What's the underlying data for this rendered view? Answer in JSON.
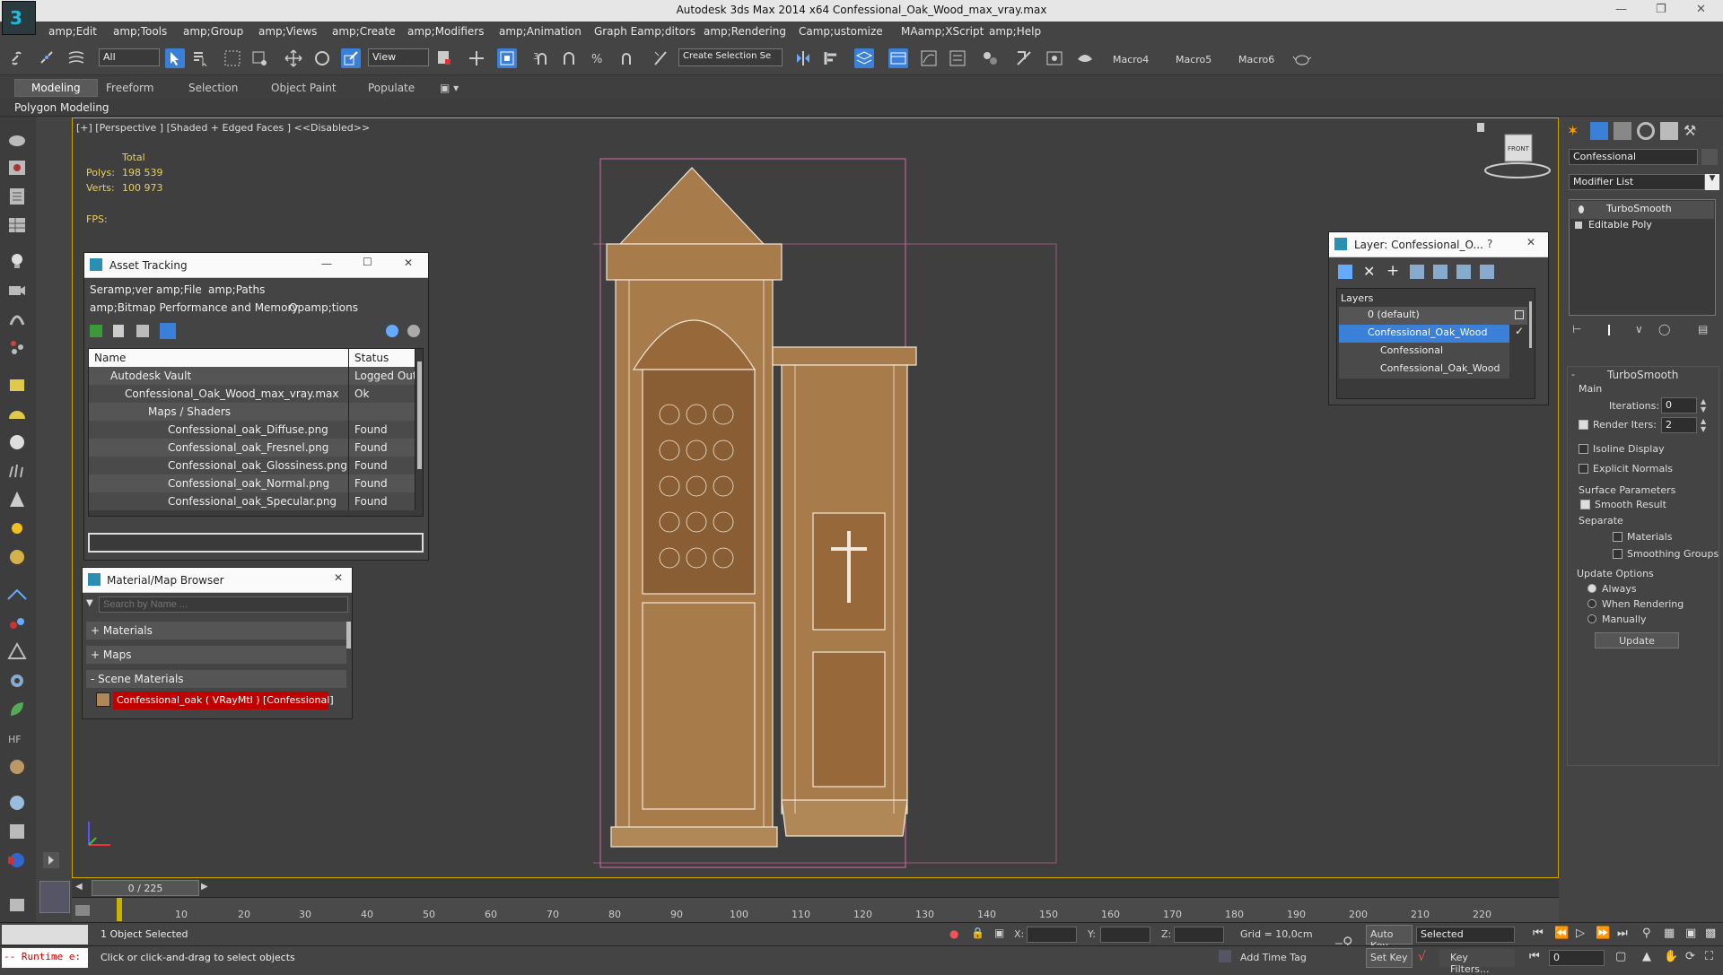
{
  "window": {
    "title": "Autodesk 3ds Max  2014 x64     Confessional_Oak_Wood_max_vray.max"
  },
  "menu": [
    "amp;Edit",
    "amp;Tools",
    "amp;Group",
    "amp;Views",
    "amp;Create",
    "amp;Modifiers",
    "amp;Animation",
    "Graph Eamp;ditors",
    "amp;Rendering",
    "Camp;ustomize",
    "MAamp;XScript",
    "amp;Help"
  ],
  "toolbar": {
    "filter_value": "All",
    "view_value": "View",
    "selection_set_placeholder": "Create Selection Se",
    "macros": [
      "Macro4",
      "Macro5",
      "Macro6"
    ]
  },
  "ribbon": {
    "tabs": [
      "Modeling",
      "Freeform",
      "Selection",
      "Object Paint",
      "Populate"
    ],
    "sub_label": "Polygon Modeling"
  },
  "viewport": {
    "label": "[+] [Perspective ] [Shaded + Edged Faces ]  <<Disabled>>",
    "stats": {
      "total": "Total",
      "polys_label": "Polys:",
      "polys": "198 539",
      "verts_label": "Verts:",
      "verts": "100 973",
      "fps_label": "FPS:"
    },
    "viewcube": "FRONT"
  },
  "asset_tracking": {
    "title": "Asset Tracking",
    "menu": [
      "Seramp;ver",
      "amp;File",
      "amp;Paths",
      "amp;Bitmap Performance and Memory",
      "Opamp;tions"
    ],
    "col_name": "Name",
    "col_status": "Status",
    "rows": [
      {
        "name": "Autodesk Vault",
        "status": "Logged Out"
      },
      {
        "name": "Confessional_Oak_Wood_max_vray.max",
        "status": "Ok"
      },
      {
        "name": "Maps / Shaders",
        "status": ""
      },
      {
        "name": "Confessional_oak_Diffuse.png",
        "status": "Found"
      },
      {
        "name": "Confessional_oak_Fresnel.png",
        "status": "Found"
      },
      {
        "name": "Confessional_oak_Glossiness.png",
        "status": "Found"
      },
      {
        "name": "Confessional_oak_Normal.png",
        "status": "Found"
      },
      {
        "name": "Confessional_oak_Specular.png",
        "status": "Found"
      }
    ]
  },
  "material_browser": {
    "title": "Material/Map Browser",
    "search_placeholder": "Search by Name ...",
    "sections": [
      "+ Materials",
      "+ Maps",
      "- Scene Materials"
    ],
    "scene_material": "Confessional_oak ( VRayMtl ) [Confessional]"
  },
  "layer_panel": {
    "title": "Layer: Confessional_O...",
    "help": "?",
    "header": "Layers",
    "rows": [
      "0 (default)",
      "Confessional_Oak_Wood",
      "Confessional",
      "Confessional_Oak_Wood"
    ]
  },
  "command_panel": {
    "object_name": "Confessional",
    "modifier_list": "Modifier List",
    "stack": [
      "TurboSmooth",
      "Editable Poly"
    ],
    "rollout": "TurboSmooth",
    "main": "Main",
    "iterations_label": "Iterations:",
    "iterations": "0",
    "render_iters_label": "Render Iters:",
    "render_iters": "2",
    "isoline": "Isoline Display",
    "explicit": "Explicit Normals",
    "surface": "Surface Parameters",
    "smooth_result": "Smooth Result",
    "separate": "Separate",
    "materials": "Materials",
    "smoothing_groups": "Smoothing Groups",
    "update_options": "Update Options",
    "always": "Always",
    "when_rendering": "When Rendering",
    "manually": "Manually",
    "update_btn": "Update"
  },
  "timeline": {
    "frame": "0 / 225",
    "ticks": [
      "10",
      "20",
      "30",
      "40",
      "50",
      "60",
      "70",
      "80",
      "90",
      "100",
      "110",
      "120",
      "130",
      "140",
      "150",
      "160",
      "170",
      "180",
      "190",
      "200",
      "210",
      "220"
    ]
  },
  "status": {
    "runtime": "-- Runtime e:",
    "selected": "1 Object Selected",
    "prompt": "Click or click-and-drag to select objects",
    "x": "X:",
    "y": "Y:",
    "z": "Z:",
    "grid": "Grid = 10,0cm",
    "add_time_tag": "Add Time Tag",
    "auto_key": "Auto Key",
    "set_key": "Set Key",
    "selected_drop": "Selected",
    "key_filters": "Key Filters...",
    "frame_field": "0"
  },
  "colors": {
    "accent": "#3a7fd8",
    "viewport_border": "#c8a400",
    "material_swatch": "#c00000",
    "wood": "#a87b4a"
  }
}
